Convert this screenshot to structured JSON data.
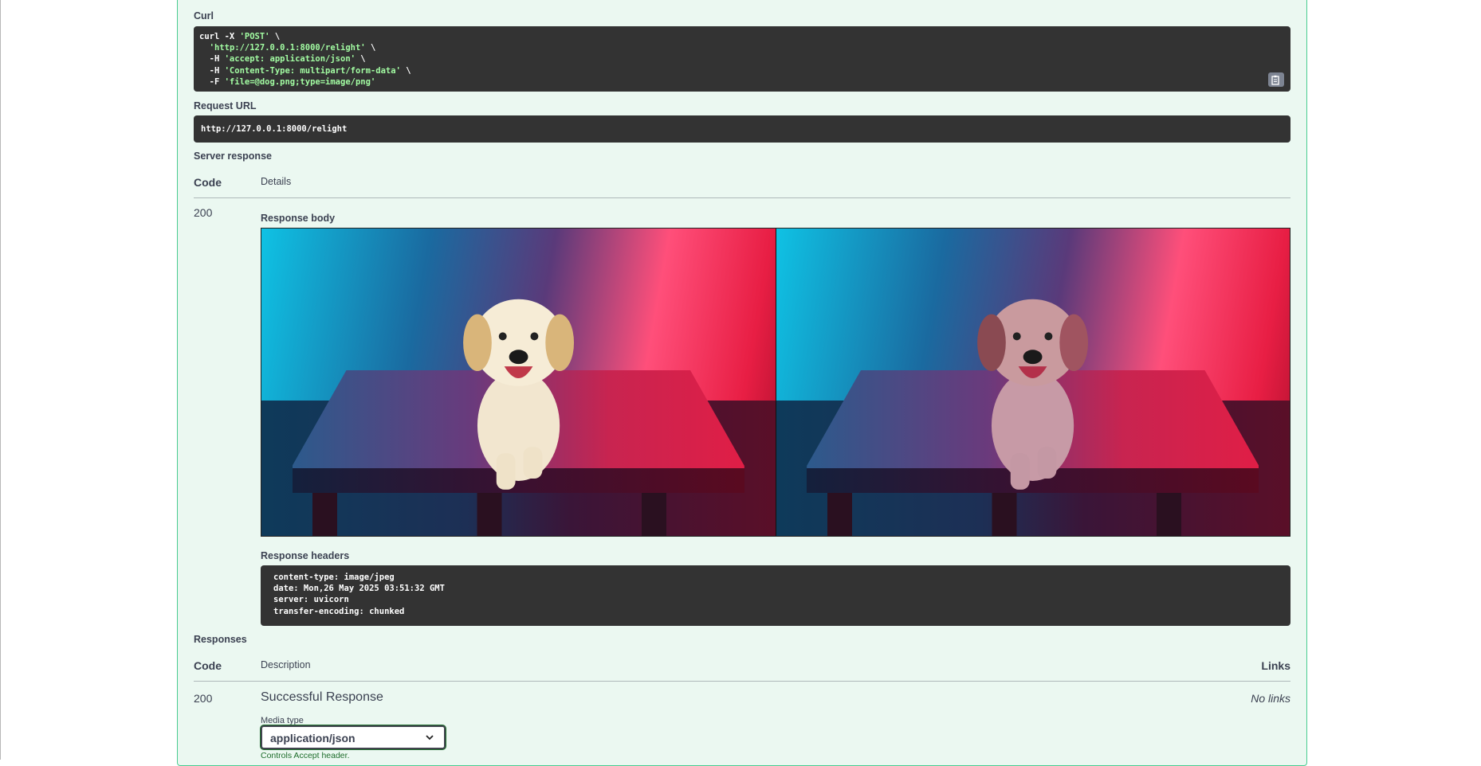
{
  "curl": {
    "label": "Curl",
    "lines": [
      {
        "plain": "curl -X ",
        "str": "'POST'",
        "tail": " \\"
      },
      {
        "plain": "  ",
        "str": "'http://127.0.0.1:8000/relight'",
        "tail": " \\"
      },
      {
        "plain": "  -H ",
        "str": "'accept: application/json'",
        "tail": " \\"
      },
      {
        "plain": "  -H ",
        "str": "'Content-Type: multipart/form-data'",
        "tail": " \\"
      },
      {
        "plain": "  -F ",
        "str": "'file=@dog.png;type=image/png'",
        "tail": ""
      }
    ],
    "copy_icon": "clipboard-icon"
  },
  "request_url": {
    "label": "Request URL",
    "value": "http://127.0.0.1:8000/relight"
  },
  "server_response": {
    "label": "Server response",
    "col_code": "Code",
    "col_details": "Details",
    "code": "200",
    "body_label": "Response body",
    "headers_label": "Response headers",
    "headers": [
      "content-type: image/jpeg",
      "date: Mon,26 May 2025 03:51:32 GMT",
      "server: uvicorn",
      "transfer-encoding: chunked"
    ]
  },
  "responses": {
    "label": "Responses",
    "col_code": "Code",
    "col_description": "Description",
    "col_links": "Links",
    "code": "200",
    "description": "Successful Response",
    "links": "No links",
    "media_type_label": "Media type",
    "media_type_value": "application/json",
    "controls_text": "Controls Accept header."
  },
  "colors": {
    "block_bg": "#ebf8f1",
    "block_border": "#49cc90",
    "code_bg": "#333333",
    "string": "#a2fca2"
  }
}
